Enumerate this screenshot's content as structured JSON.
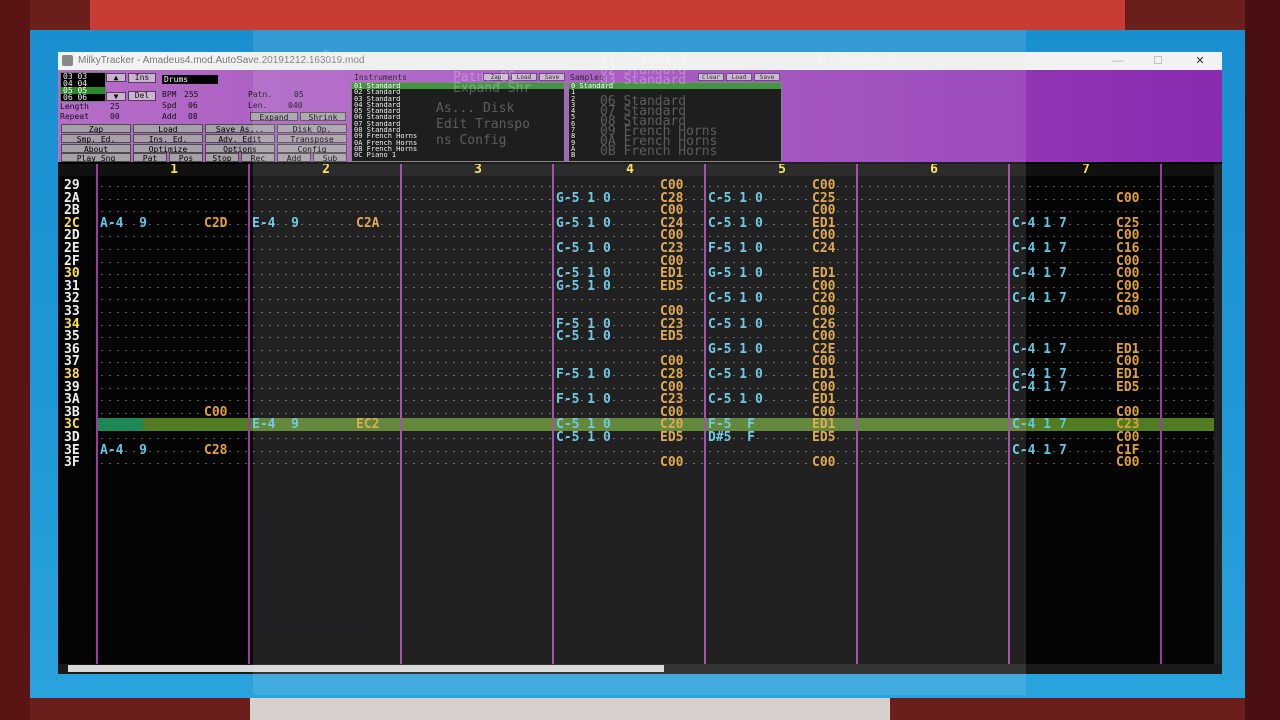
{
  "window": {
    "title": "MilkyTracker - Amadeus4.mod.AutoSave.20191212.163019.mod",
    "minimize": "—",
    "maximize": "☐",
    "close": "✕"
  },
  "song": {
    "order_rows": [
      "03 03",
      "04 04",
      "05 05",
      "06 06"
    ],
    "title_label": "Drums",
    "ins_label": "Ins",
    "del_label": "Del",
    "length_label": "Length",
    "length_value": "25",
    "repeat_label": "Repeat",
    "repeat_value": "00",
    "bpm_label": "BPM",
    "bpm_value": "255",
    "spd_label": "Spd",
    "spd_value": "06",
    "add_label": "Add",
    "add_value": "08",
    "patn_label": "Patn.",
    "patn_value": "05",
    "len_label": "Len.",
    "len_value": "040",
    "expand": "Expand",
    "shrink": "Shrink"
  },
  "main_buttons": [
    [
      "Zap",
      "Load",
      "Save As...",
      "Disk Op."
    ],
    [
      "Smp. Ed.",
      "Ins. Ed.",
      "Adv. Edit",
      "Transpose"
    ],
    [
      "About",
      "Optimize",
      "Options",
      "Config"
    ],
    [
      "Play Sng",
      "Pat",
      "Pos",
      "Stop",
      "Rec",
      "Add",
      "Sub"
    ]
  ],
  "instruments": {
    "header": "Instruments",
    "zap": "Zap",
    "load": "Load",
    "save": "Save",
    "items": [
      "01 Standard",
      "02 Standard",
      "03 Standard",
      "04 Standard",
      "05 Standard",
      "06 Standard",
      "07 Standard",
      "08 Standard",
      "09 French Horns",
      "0A French Horns",
      "0B French Horns",
      "0C Piano 1"
    ]
  },
  "samples": {
    "header": "Samples",
    "clear": "Clear",
    "load": "Load",
    "save": "Save",
    "items": [
      "0 Standard",
      "1",
      "2",
      "3",
      "4",
      "5",
      "6",
      "7",
      "8",
      "9",
      "A",
      "B"
    ]
  },
  "ghost_overlay": {
    "drums": "Drums",
    "patn": "Patn. 05",
    "list": [
      "01 Standard",
      "02 Standard",
      "03 Standard",
      "05 Standard",
      "06 Standard",
      "07 Standard",
      "08 Standard",
      "09 French Horns",
      "0A French Horns",
      "0B French Horns",
      "0C Piano 1"
    ],
    "sample0": "0 Standard",
    "expand_shrink": "Expand Shr",
    "buttons": [
      "As...  Disk",
      "Edit  Transpo",
      "ns    Config"
    ]
  },
  "pattern": {
    "channels": [
      "1",
      "2",
      "3",
      "4",
      "5",
      "6",
      "7"
    ],
    "rows": [
      {
        "num": "29",
        "hl": false,
        "c4": {
          "n": "",
          "f": "C00"
        },
        "c5": {
          "n": "",
          "f": "C00"
        },
        "c7": {
          "n": "",
          "f": ""
        }
      },
      {
        "num": "2A",
        "hl": false,
        "c4": {
          "n": "G-5 1 0",
          "f": "C28"
        },
        "c5": {
          "n": "C-5 1 0",
          "f": "C25"
        },
        "c7": {
          "n": "",
          "f": "C00"
        }
      },
      {
        "num": "2B",
        "hl": false,
        "c4": {
          "n": "",
          "f": "C00"
        },
        "c5": {
          "n": "",
          "f": "C00"
        },
        "c7": {
          "n": "",
          "f": ""
        }
      },
      {
        "num": "2C",
        "hl": true,
        "c1": {
          "n": "A-4  9",
          "f": "C2D"
        },
        "c2": {
          "n": "E-4  9",
          "f": "C2A"
        },
        "c4": {
          "n": "G-5 1 0",
          "f": "C24"
        },
        "c5": {
          "n": "C-5 1 0",
          "f": "ED1"
        },
        "c7": {
          "n": "C-4 1 7",
          "f": "C25"
        }
      },
      {
        "num": "2D",
        "hl": false,
        "c4": {
          "n": "",
          "f": "C00"
        },
        "c5": {
          "n": "",
          "f": "C00"
        },
        "c7": {
          "n": "",
          "f": "C00"
        }
      },
      {
        "num": "2E",
        "hl": false,
        "c4": {
          "n": "C-5 1 0",
          "f": "C23"
        },
        "c5": {
          "n": "F-5 1 0",
          "f": "C24"
        },
        "c7": {
          "n": "C-4 1 7",
          "f": "C16"
        }
      },
      {
        "num": "2F",
        "hl": false,
        "c4": {
          "n": "",
          "f": "C00"
        },
        "c5": {
          "n": "",
          "f": ""
        },
        "c7": {
          "n": "",
          "f": "C00"
        }
      },
      {
        "num": "30",
        "hl": true,
        "c4": {
          "n": "C-5 1 0",
          "f": "ED1"
        },
        "c5": {
          "n": "G-5 1 0",
          "f": "ED1"
        },
        "c7": {
          "n": "C-4 1 7",
          "f": "C00"
        }
      },
      {
        "num": "31",
        "hl": false,
        "c4": {
          "n": "G-5 1 0",
          "f": "ED5"
        },
        "c5": {
          "n": "",
          "f": "C00"
        },
        "c7": {
          "n": "",
          "f": "C00"
        }
      },
      {
        "num": "32",
        "hl": false,
        "c4": {
          "n": "",
          "f": ""
        },
        "c5": {
          "n": "C-5 1 0",
          "f": "C20"
        },
        "c7": {
          "n": "C-4 1 7",
          "f": "C29"
        }
      },
      {
        "num": "33",
        "hl": false,
        "c4": {
          "n": "",
          "f": "C00"
        },
        "c5": {
          "n": "",
          "f": "C00"
        },
        "c7": {
          "n": "",
          "f": "C00"
        }
      },
      {
        "num": "34",
        "hl": true,
        "c4": {
          "n": "F-5 1 0",
          "f": "C23"
        },
        "c5": {
          "n": "C-5 1 0",
          "f": "C26"
        },
        "c7": {
          "n": "",
          "f": ""
        }
      },
      {
        "num": "35",
        "hl": false,
        "c4": {
          "n": "C-5 1 0",
          "f": "ED5"
        },
        "c5": {
          "n": "",
          "f": "C00"
        },
        "c7": {
          "n": "",
          "f": ""
        }
      },
      {
        "num": "36",
        "hl": false,
        "c4": {
          "n": "",
          "f": ""
        },
        "c5": {
          "n": "G-5 1 0",
          "f": "C2E"
        },
        "c7": {
          "n": "C-4 1 7",
          "f": "ED1"
        }
      },
      {
        "num": "37",
        "hl": false,
        "c4": {
          "n": "",
          "f": "C00"
        },
        "c5": {
          "n": "",
          "f": "C00"
        },
        "c7": {
          "n": "",
          "f": "C00"
        }
      },
      {
        "num": "38",
        "hl": true,
        "c4": {
          "n": "F-5 1 0",
          "f": "C28"
        },
        "c5": {
          "n": "C-5 1 0",
          "f": "ED1"
        },
        "c7": {
          "n": "C-4 1 7",
          "f": "ED1"
        }
      },
      {
        "num": "39",
        "hl": false,
        "c4": {
          "n": "",
          "f": "C00"
        },
        "c5": {
          "n": "",
          "f": "C00"
        },
        "c7": {
          "n": "C-4 1 7",
          "f": "ED5"
        }
      },
      {
        "num": "3A",
        "hl": false,
        "c4": {
          "n": "F-5 1 0",
          "f": "C23"
        },
        "c5": {
          "n": "C-5 1 0",
          "f": "ED1"
        },
        "c7": {
          "n": "",
          "f": ""
        }
      },
      {
        "num": "3B",
        "hl": false,
        "c1": {
          "n": "",
          "f": "C00"
        },
        "c4": {
          "n": "",
          "f": "C00"
        },
        "c5": {
          "n": "",
          "f": "C00"
        },
        "c7": {
          "n": "",
          "f": "C00"
        }
      },
      {
        "num": "3C",
        "hl": true,
        "c2": {
          "n": "E-4  9",
          "f": "EC2"
        },
        "c4": {
          "n": "C-5 1 0",
          "f": "C20"
        },
        "c5": {
          "n": "F-5  F",
          "f": "ED1"
        },
        "c7": {
          "n": "C-4 1 7",
          "f": "C23"
        }
      },
      {
        "num": "3D",
        "hl": false,
        "c4": {
          "n": "C-5 1 0",
          "f": "ED5"
        },
        "c5": {
          "n": "D#5  F",
          "f": "ED5"
        },
        "c7": {
          "n": "",
          "f": "C00"
        }
      },
      {
        "num": "3E",
        "hl": false,
        "c1": {
          "n": "A-4  9",
          "f": "C28"
        },
        "c4": {
          "n": "",
          "f": ""
        },
        "c5": {
          "n": "",
          "f": ""
        },
        "c7": {
          "n": "C-4 1 7",
          "f": "C1F"
        }
      },
      {
        "num": "3F",
        "hl": false,
        "c4": {
          "n": "",
          "f": "C00"
        },
        "c5": {
          "n": "",
          "f": "C00"
        },
        "c7": {
          "n": "",
          "f": "C00"
        }
      }
    ]
  },
  "colors": {
    "row_highlight": "#ffe14a",
    "row_normal": "#f0f0f0",
    "note": "#5fc6e6",
    "effect": "#e0a03a",
    "channel_separator": "#9a3d9e",
    "cursor": "#6aa52a"
  }
}
